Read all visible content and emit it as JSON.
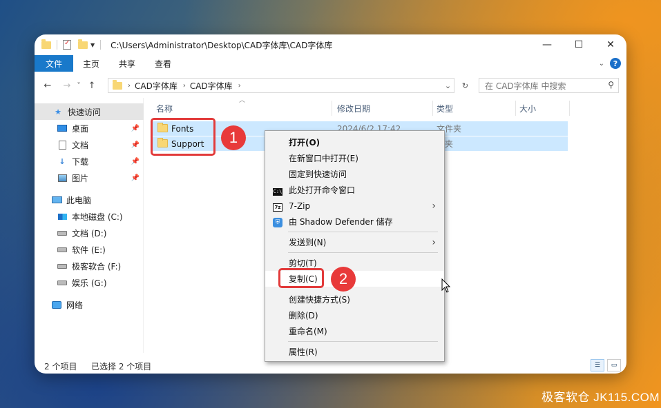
{
  "titlebar": {
    "path": "C:\\Users\\Administrator\\Desktop\\CAD字体库\\CAD字体库",
    "minimize": "—",
    "maximize": "☐",
    "close": "✕"
  },
  "ribbon": {
    "tabs": [
      "文件",
      "主页",
      "共享",
      "查看"
    ],
    "help": "?"
  },
  "nav": {
    "back": "←",
    "forward": "→",
    "recent": "˅",
    "up": "↑",
    "breadcrumb": [
      "CAD字体库",
      "CAD字体库"
    ],
    "search_placeholder": "在 CAD字体库 中搜索"
  },
  "sidebar": {
    "items": [
      {
        "label": "快速访问",
        "icon": "star-icon"
      },
      {
        "label": "桌面",
        "icon": "desktop-icon",
        "pinned": true
      },
      {
        "label": "文档",
        "icon": "document-icon",
        "pinned": true
      },
      {
        "label": "下载",
        "icon": "download-icon",
        "pinned": true
      },
      {
        "label": "图片",
        "icon": "pictures-icon",
        "pinned": true
      },
      {
        "label": "此电脑",
        "icon": "computer-icon"
      },
      {
        "label": "本地磁盘 (C:)",
        "icon": "drive-c-icon"
      },
      {
        "label": "文档 (D:)",
        "icon": "drive-icon"
      },
      {
        "label": "软件 (E:)",
        "icon": "drive-icon"
      },
      {
        "label": "极客软合 (F:)",
        "icon": "drive-icon"
      },
      {
        "label": "娱乐 (G:)",
        "icon": "drive-icon"
      },
      {
        "label": "网络",
        "icon": "network-icon"
      }
    ]
  },
  "columns": [
    "名称",
    "修改日期",
    "类型",
    "大小"
  ],
  "files": [
    {
      "name": "Fonts",
      "date": "2024/6/2 17:42",
      "type": "文件夹"
    },
    {
      "name": "Support",
      "date": "",
      "type": "件夹"
    }
  ],
  "context_menu": {
    "items": [
      {
        "label": "打开(O)",
        "bold": true
      },
      {
        "label": "在新窗口中打开(E)"
      },
      {
        "label": "固定到快速访问"
      },
      {
        "label": "此处打开命令窗口",
        "icon": "cmd-icon"
      },
      {
        "label": "7-Zip",
        "icon": "7zip-icon",
        "submenu": true
      },
      {
        "label": "由 Shadow Defender 储存",
        "icon": "shield-icon"
      },
      {
        "label": "发送到(N)",
        "submenu": true
      },
      {
        "label": "剪切(T)"
      },
      {
        "label": "复制(C)",
        "highlighted": true
      },
      {
        "label": "创建快捷方式(S)"
      },
      {
        "label": "删除(D)"
      },
      {
        "label": "重命名(M)"
      },
      {
        "label": "属性(R)"
      }
    ],
    "cmd_icon_text": "C:\\",
    "zip_icon_text": "7z"
  },
  "annotations": {
    "badge1": "1",
    "badge2": "2"
  },
  "status": {
    "count": "2 个项目",
    "selected": "已选择 2 个项目"
  },
  "watermark": "极客软仓 JK115.COM",
  "colors": {
    "file_tab": "#1979ca",
    "selection": "#cce8ff",
    "annotation_red": "#e23b3b"
  }
}
